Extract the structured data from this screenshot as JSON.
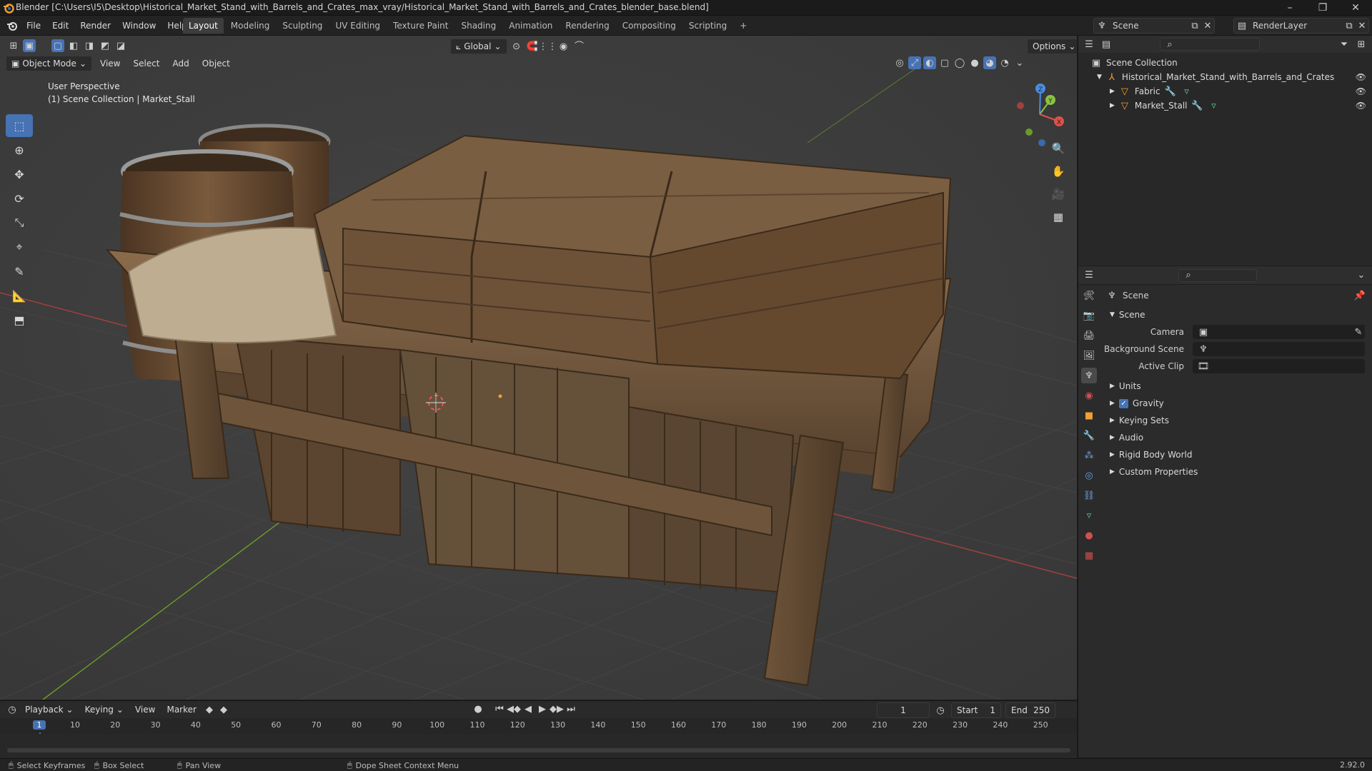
{
  "window": {
    "title": "Blender [C:\\Users\\I5\\Desktop\\Historical_Market_Stand_with_Barrels_and_Crates_max_vray/Historical_Market_Stand_with_Barrels_and_Crates_blender_base.blend]",
    "minimize": "–",
    "maximize": "❐",
    "close": "✕"
  },
  "menu": [
    "File",
    "Edit",
    "Render",
    "Window",
    "Help"
  ],
  "workspaces": [
    "Layout",
    "Modeling",
    "Sculpting",
    "UV Editing",
    "Texture Paint",
    "Shading",
    "Animation",
    "Rendering",
    "Compositing",
    "Scripting"
  ],
  "workspace_add": "+",
  "scene_selector": "Scene",
  "render_layer": "RenderLayer",
  "viewport": {
    "mode": "Object Mode",
    "menus": [
      "View",
      "Select",
      "Add",
      "Object"
    ],
    "transform_orientation": "Global",
    "options": "Options",
    "perspective": "User Perspective",
    "collection_info": "(1) Scene Collection | Market_Stall",
    "gizmo_axes": {
      "x": "X",
      "y": "Y",
      "z": "Z"
    }
  },
  "outliner": {
    "root": "Scene Collection",
    "items": [
      {
        "label": "Historical_Market_Stand_with_Barrels_and_Crates",
        "level": 1
      },
      {
        "label": "Fabric",
        "level": 2
      },
      {
        "label": "Market_Stall",
        "level": 2
      }
    ]
  },
  "properties": {
    "context": "Scene",
    "panel_title": "Scene",
    "fields": [
      {
        "label": "Camera",
        "value": ""
      },
      {
        "label": "Background Scene",
        "value": ""
      },
      {
        "label": "Active Clip",
        "value": ""
      }
    ],
    "sections": [
      "Units",
      "Gravity",
      "Keying Sets",
      "Audio",
      "Rigid Body World",
      "Custom Properties"
    ],
    "gravity_checked": true
  },
  "timeline": {
    "menus": [
      "Playback",
      "Keying",
      "View",
      "Marker"
    ],
    "current_frame": "1",
    "start_label": "Start",
    "start": "1",
    "end_label": "End",
    "end": "250",
    "ruler": [
      "1",
      "10",
      "20",
      "30",
      "40",
      "50",
      "60",
      "70",
      "80",
      "90",
      "100",
      "110",
      "120",
      "130",
      "140",
      "150",
      "160",
      "170",
      "180",
      "190",
      "200",
      "210",
      "220",
      "230",
      "240",
      "250"
    ]
  },
  "status": {
    "items": [
      "Select Keyframes",
      "Box Select",
      "Pan View",
      "Dope Sheet Context Menu"
    ],
    "version": "2.92.0"
  }
}
